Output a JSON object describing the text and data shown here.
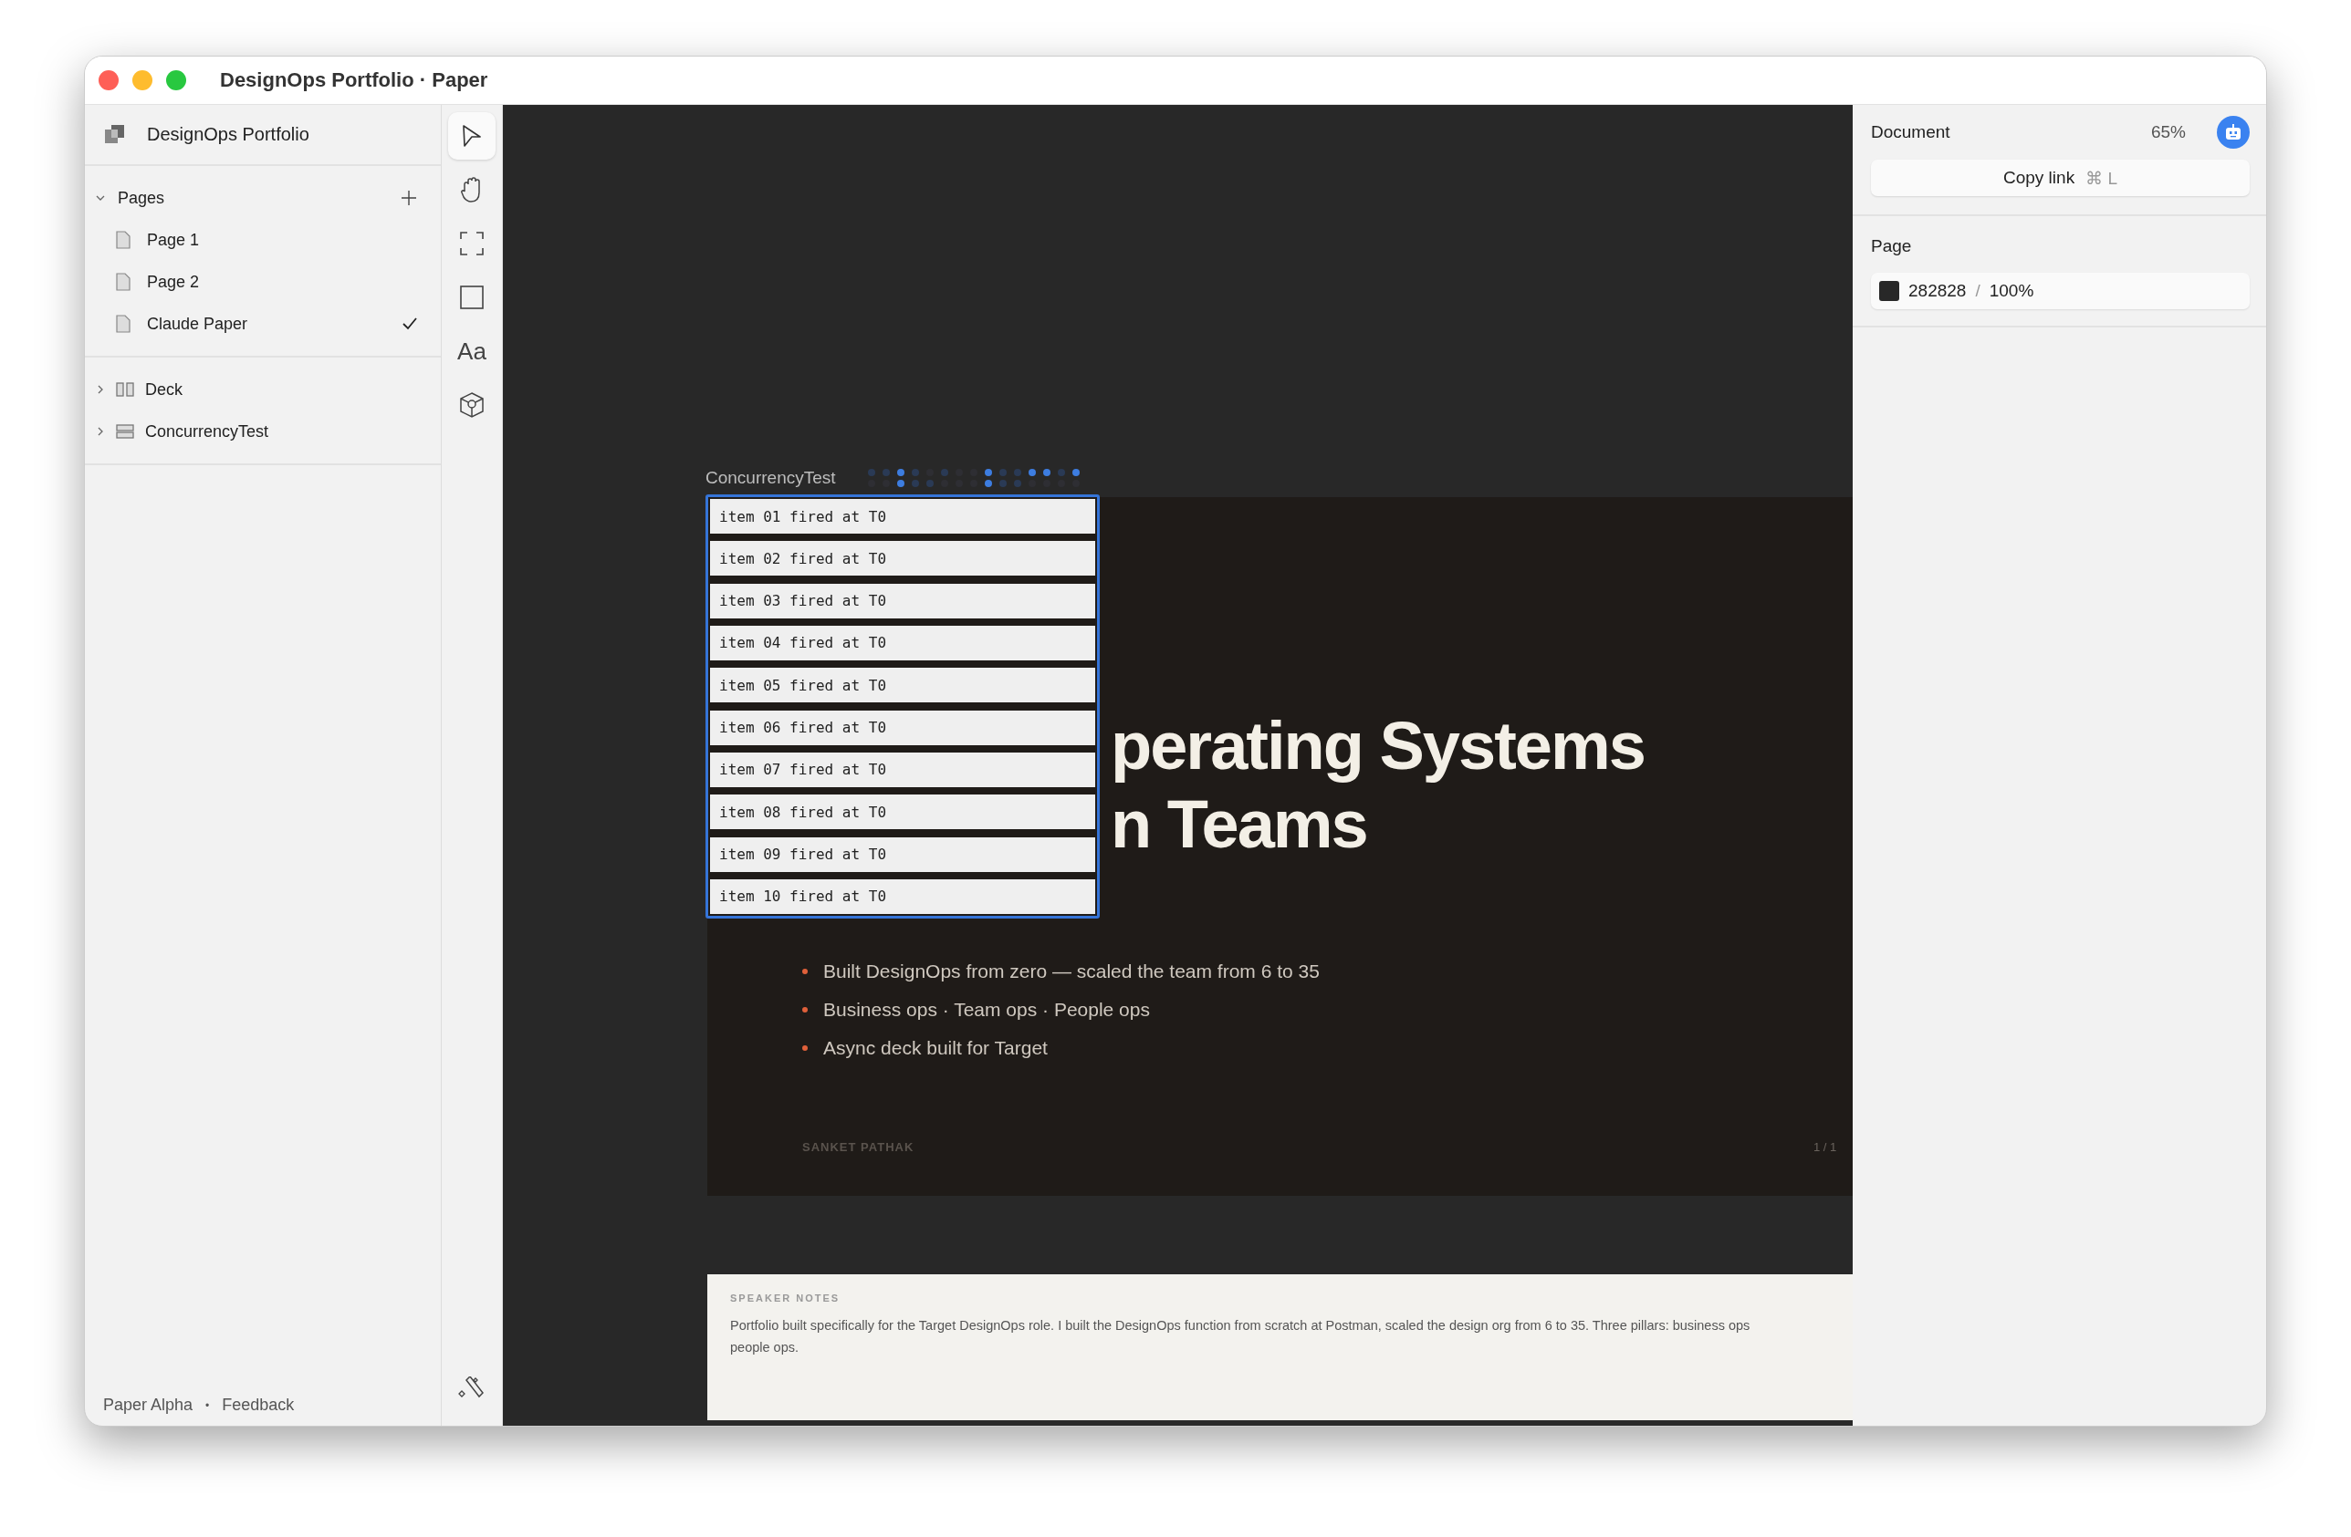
{
  "window": {
    "title": "DesignOps Portfolio · Paper"
  },
  "sidebar": {
    "project": "DesignOps Portfolio",
    "pages_header": {
      "label": "Pages",
      "expanded": true
    },
    "pages": [
      {
        "label": "Page 1",
        "selected": false
      },
      {
        "label": "Page 2",
        "selected": false
      },
      {
        "label": "Claude Paper",
        "selected": true
      }
    ],
    "layers": [
      {
        "label": "Deck",
        "kind": "deck",
        "expanded": false
      },
      {
        "label": "ConcurrencyTest",
        "kind": "stack",
        "expanded": false
      }
    ],
    "footer": {
      "version": "Paper Alpha",
      "separator": "•",
      "link": "Feedback"
    }
  },
  "tools": [
    {
      "kind": "select",
      "selected": true
    },
    {
      "kind": "hand",
      "selected": false
    },
    {
      "kind": "frame",
      "selected": false
    },
    {
      "kind": "rect",
      "selected": false
    },
    {
      "kind": "text",
      "label": "Aa",
      "selected": false
    },
    {
      "kind": "component",
      "selected": false
    }
  ],
  "bottom_tool": {
    "kind": "wand"
  },
  "canvas": {
    "frame_label": "ConcurrencyTest",
    "list_items": [
      "item 01 fired at T0",
      "item 02 fired at T0",
      "item 03 fired at T0",
      "item 04 fired at T0",
      "item 05 fired at T0",
      "item 06 fired at T0",
      "item 07 fired at T0",
      "item 08 fired at T0",
      "item 09 fired at T0",
      "item 10 fired at T0"
    ],
    "slide": {
      "title_lines": [
        "perating Systems",
        "n Teams"
      ],
      "bullets": [
        "Built DesignOps from zero — scaled the team from 6 to 35",
        "Business ops · Team ops · People ops",
        "Async deck built for Target"
      ],
      "author": "SANKET PATHAK",
      "page_number": "1 / 1"
    },
    "speaker_notes": {
      "heading": "SPEAKER NOTES",
      "lines": [
        "Portfolio built specifically for the Target DesignOps role. I built the DesignOps function from scratch at Postman, scaled the design org from 6 to 35. Three pillars: business ops",
        "people ops."
      ]
    }
  },
  "panel": {
    "document": {
      "label": "Document",
      "zoom": "65%"
    },
    "copy_link": {
      "label": "Copy link",
      "shortcut": "⌘ L"
    },
    "page": {
      "label": "Page",
      "hex": "282828",
      "separator": "/",
      "opacity": "100%"
    }
  }
}
